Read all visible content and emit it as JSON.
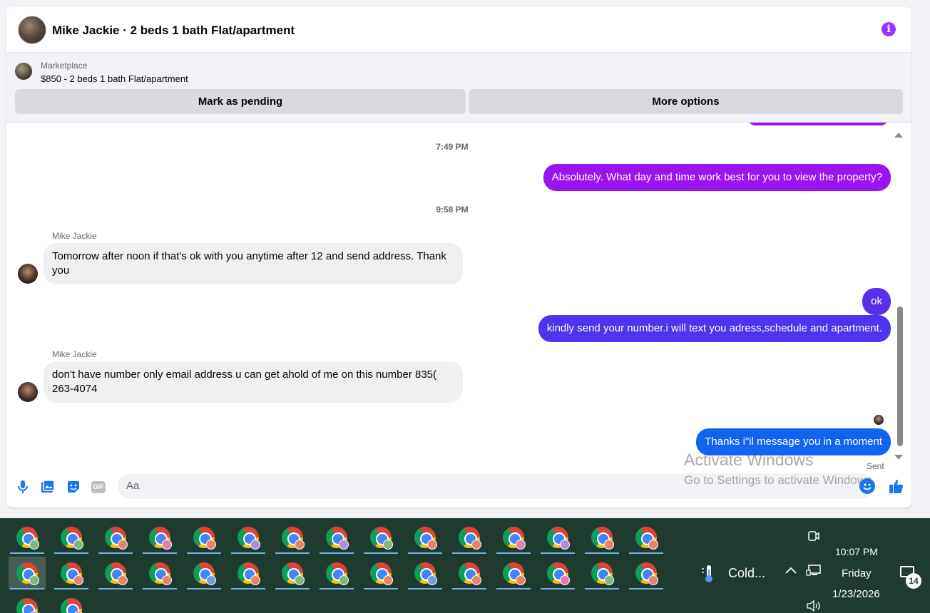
{
  "header": {
    "title": "Mike Jackie · 2 beds 1 bath Flat/apartment",
    "accent_color": "#a033ff"
  },
  "listing": {
    "label": "Marketplace",
    "price_title": "$850 - 2 beds 1 bath Flat/apartment",
    "pending_label": "Mark as pending",
    "more_label": "More options"
  },
  "messages": [
    {
      "type": "timestamp",
      "text": "7:49 PM"
    },
    {
      "type": "outgoing",
      "text": "Absolutely. What day and time work best for you to view the property?",
      "color": "#9b14f0"
    },
    {
      "type": "timestamp",
      "text": "9:58 PM"
    },
    {
      "type": "incoming",
      "sender": "Mike Jackie",
      "text": "Tomorrow after noon if that's ok with you anytime after 12 and send address. Thank you"
    },
    {
      "type": "outgoing",
      "text": "ok",
      "color": "#5b2ee8"
    },
    {
      "type": "outgoing",
      "text": "kindly send your number.i will text you adress,schedule and apartment.",
      "color": "#4d34ee"
    },
    {
      "type": "incoming",
      "sender": "Mike Jackie",
      "text": "don't have number only email address u can get ahold of me on this number 835( 263-4074"
    },
    {
      "type": "outgoing",
      "text": "Thanks i\"il message you in a moment",
      "color": "#1263ef",
      "status": "Sent"
    }
  ],
  "composer": {
    "placeholder": "Aa",
    "icons": [
      "microphone-icon",
      "photo-icon",
      "sticker-icon",
      "gif-icon",
      "emoji-icon",
      "thumbs-up-icon"
    ],
    "gif_label": "GIF",
    "accent_color": "#1877f2"
  },
  "watermark": {
    "line1": "Activate Windows",
    "line2": "Go to Settings to activate Windows."
  },
  "taskbar": {
    "app_icon": "chrome-icon",
    "row1_badges": [
      "#7fb77e",
      "#7fb77e",
      "#e8836b",
      "#e67ab0",
      "#e8836b",
      "#b78ad8",
      "#e8836b",
      "#b78ad8",
      "#7fb77e",
      "#e8836b",
      "#e8836b",
      "#e67ab0",
      "#b78ad8",
      "#e8836b",
      "#e8836b"
    ],
    "row2_badges": [
      "#7fb77e",
      "#e8836b",
      "#e8836b",
      "#e8836b",
      "#6fa3d8",
      "#e8836b",
      "#7fb77e",
      "#7fb77e",
      "#e8836b",
      "#6fa3d8",
      "#e8836b",
      "#e8836b",
      "#e67ab0",
      "#7fb77e",
      "#e8836b"
    ],
    "row3_badges": [
      "#b78ad8",
      "#e8836b"
    ],
    "weather_text": "Cold...",
    "time": "10:07 PM",
    "day": "Friday",
    "date": "1/23/2026",
    "notification_count": "14"
  }
}
